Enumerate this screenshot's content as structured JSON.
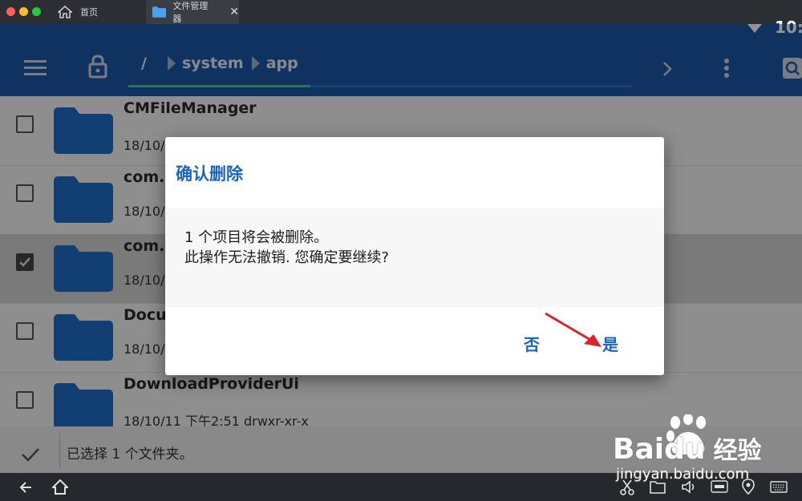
{
  "window": {
    "tabs": [
      {
        "label": "首页",
        "icon": "home-icon"
      },
      {
        "label": "文件管理器",
        "icon": "folder-icon"
      }
    ],
    "clock": "10:.."
  },
  "appbar": {
    "breadcrumbs": [
      "/",
      "system",
      "app"
    ]
  },
  "files": [
    {
      "name": "CMFileManager",
      "meta": "18/10/11 下午2:51   drwxr-xr-x",
      "selected": false
    },
    {
      "name": "com.r",
      "meta": "18/10/",
      "selected": false
    },
    {
      "name": "com.r",
      "meta": "18/10/",
      "selected": true
    },
    {
      "name": "Docu",
      "meta": "18/10/",
      "selected": false
    },
    {
      "name": "DownloadProviderUi",
      "meta": "18/10/11 下午2:51   drwxr-xr-x",
      "selected": false
    }
  ],
  "status": {
    "selection_text": "已选择 1 个文件夹。"
  },
  "dialog": {
    "title": "确认删除",
    "message_line1": "1 个项目将会被删除。",
    "message_line2": "此操作无法撤销. 您确定要继续?",
    "no_label": "否",
    "yes_label": "是"
  },
  "watermark": {
    "brand": "Baidu",
    "brand_cn": "经验",
    "url": "jingyan.baidu.com"
  },
  "colors": {
    "accent": "#1a65bf",
    "appbar": "#1a57a8",
    "arrow": "#d9252a"
  }
}
